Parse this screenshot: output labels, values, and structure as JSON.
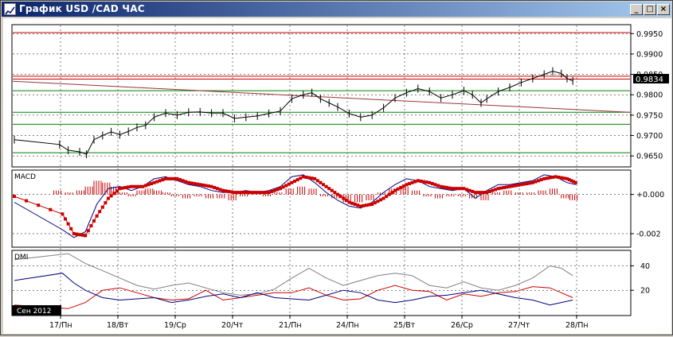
{
  "window": {
    "title": "График USD /CAD  ЧАС",
    "minimize_label": "_",
    "maximize_label": "□",
    "close_label": "×"
  },
  "price_panel": {
    "ticks": [
      "0.9950",
      "0.9900",
      "0.9850",
      "0.9800",
      "0.9750",
      "0.9700",
      "0.9650"
    ],
    "current_price": "0.9834",
    "current_price_value": 0.9834,
    "ylim": [
      0.9625,
      0.997
    ],
    "horizontal_levels": [
      {
        "value": 0.99525,
        "color": "#cc0000"
      },
      {
        "value": 0.98455,
        "color": "#cc0000"
      },
      {
        "value": 0.98385,
        "color": "#cc0000"
      },
      {
        "value": 0.981,
        "color": "#008000"
      },
      {
        "value": 0.9757,
        "color": "#008000"
      },
      {
        "value": 0.97275,
        "color": "#008000"
      },
      {
        "value": 0.9658,
        "color": "#008000"
      }
    ],
    "trendline": {
      "color": "#993333",
      "start": [
        0.0,
        0.9833
      ],
      "end": [
        10.4,
        0.9757
      ]
    },
    "price_series": [
      [
        0.0,
        0.969
      ],
      [
        0.15,
        0.9678
      ],
      [
        0.3,
        0.9664
      ],
      [
        0.5,
        0.966
      ],
      [
        0.62,
        0.9654
      ],
      [
        0.75,
        0.969
      ],
      [
        0.9,
        0.97
      ],
      [
        1.05,
        0.9709
      ],
      [
        1.2,
        0.9702
      ],
      [
        1.35,
        0.971
      ],
      [
        1.5,
        0.972
      ],
      [
        1.65,
        0.9725
      ],
      [
        1.8,
        0.9745
      ],
      [
        2.0,
        0.9755
      ],
      [
        2.2,
        0.975
      ],
      [
        2.4,
        0.9757
      ],
      [
        2.6,
        0.9758
      ],
      [
        2.8,
        0.9755
      ],
      [
        3.0,
        0.9755
      ],
      [
        3.2,
        0.9742
      ],
      [
        3.4,
        0.9745
      ],
      [
        3.6,
        0.9748
      ],
      [
        3.8,
        0.9754
      ],
      [
        4.0,
        0.976
      ],
      [
        4.2,
        0.979
      ],
      [
        4.4,
        0.98
      ],
      [
        4.55,
        0.9805
      ],
      [
        4.7,
        0.979
      ],
      [
        4.85,
        0.978
      ],
      [
        5.0,
        0.977
      ],
      [
        5.2,
        0.9754
      ],
      [
        5.4,
        0.9745
      ],
      [
        5.6,
        0.975
      ],
      [
        5.8,
        0.9768
      ],
      [
        6.0,
        0.9792
      ],
      [
        6.2,
        0.9805
      ],
      [
        6.4,
        0.9815
      ],
      [
        6.6,
        0.9808
      ],
      [
        6.8,
        0.9792
      ],
      [
        7.0,
        0.98
      ],
      [
        7.2,
        0.981
      ],
      [
        7.35,
        0.98
      ],
      [
        7.5,
        0.978
      ],
      [
        7.6,
        0.979
      ],
      [
        7.8,
        0.9808
      ],
      [
        8.0,
        0.9818
      ],
      [
        8.2,
        0.983
      ],
      [
        8.4,
        0.984
      ],
      [
        8.6,
        0.985
      ],
      [
        8.75,
        0.9858
      ],
      [
        8.9,
        0.9852
      ],
      [
        9.0,
        0.984
      ],
      [
        9.1,
        0.9834
      ]
    ]
  },
  "macd_panel": {
    "label": "MACD",
    "ticks": [
      "+0.000",
      "-0.002"
    ],
    "ylim": [
      -0.00265,
      0.0012
    ],
    "histogram_color": "#cc0000",
    "histogram": [
      [
        0.05,
        0.0002
      ],
      [
        0.25,
        0.0001
      ],
      [
        0.45,
        0.0002
      ],
      [
        0.6,
        0.0004
      ],
      [
        0.75,
        0.0007
      ],
      [
        0.9,
        0.0006
      ],
      [
        1.05,
        0.0004
      ],
      [
        1.2,
        0.0001
      ],
      [
        1.35,
        -0.0001
      ],
      [
        1.5,
        0.0002
      ],
      [
        1.65,
        0.0003
      ],
      [
        1.8,
        0.0002
      ],
      [
        1.95,
        0.0001
      ],
      [
        2.1,
        -0.0001
      ],
      [
        2.3,
        -0.0002
      ],
      [
        2.5,
        -0.0001
      ],
      [
        2.7,
        -0.0002
      ],
      [
        2.9,
        -0.0002
      ],
      [
        3.1,
        -0.0003
      ],
      [
        3.3,
        -0.0001
      ],
      [
        3.5,
        0.0001
      ],
      [
        3.7,
        -0.0001
      ],
      [
        3.9,
        0.0001
      ],
      [
        4.1,
        0.0003
      ],
      [
        4.3,
        0.0004
      ],
      [
        4.5,
        0.0003
      ],
      [
        4.7,
        -0.0001
      ],
      [
        4.9,
        -0.0002
      ],
      [
        5.1,
        -0.0004
      ],
      [
        5.3,
        -0.0004
      ],
      [
        5.5,
        -0.0003
      ],
      [
        5.7,
        0.0001
      ],
      [
        5.9,
        0.0003
      ],
      [
        6.1,
        0.0004
      ],
      [
        6.3,
        0.0002
      ],
      [
        6.5,
        -0.0001
      ],
      [
        6.7,
        -0.0002
      ],
      [
        6.9,
        -0.0001
      ],
      [
        7.1,
        -0.0001
      ],
      [
        7.3,
        -0.0002
      ],
      [
        7.5,
        -0.0003
      ],
      [
        7.7,
        0.0001
      ],
      [
        7.9,
        0.0002
      ],
      [
        8.1,
        0.0001
      ],
      [
        8.3,
        0.0001
      ],
      [
        8.5,
        0.0002
      ],
      [
        8.7,
        0.0003
      ],
      [
        8.9,
        -0.0002
      ],
      [
        9.05,
        -0.0003
      ]
    ],
    "macd_line": {
      "color": "#000080",
      "points": [
        [
          0.0,
          -0.0004
        ],
        [
          0.2,
          -0.0018
        ],
        [
          0.4,
          -0.0022
        ],
        [
          0.6,
          -0.0019
        ],
        [
          0.8,
          -0.0005
        ],
        [
          1.0,
          0.0003
        ],
        [
          1.2,
          0.0004
        ],
        [
          1.4,
          0.0002
        ],
        [
          1.6,
          0.0004
        ],
        [
          1.8,
          0.0008
        ],
        [
          2.0,
          0.0009
        ],
        [
          2.2,
          0.0007
        ],
        [
          2.4,
          0.0005
        ],
        [
          2.6,
          0.0004
        ],
        [
          2.8,
          0.0002
        ],
        [
          3.0,
          0.0001
        ],
        [
          3.2,
          0.0001
        ],
        [
          3.4,
          0.0002
        ],
        [
          3.6,
          0.0001
        ],
        [
          3.8,
          0.0002
        ],
        [
          4.0,
          0.0004
        ],
        [
          4.2,
          0.0009
        ],
        [
          4.4,
          0.001
        ],
        [
          4.6,
          0.0006
        ],
        [
          4.8,
          0.0001
        ],
        [
          5.0,
          -0.0003
        ],
        [
          5.2,
          -0.0006
        ],
        [
          5.4,
          -0.0007
        ],
        [
          5.6,
          -0.0004
        ],
        [
          5.8,
          0.0001
        ],
        [
          6.0,
          0.0005
        ],
        [
          6.2,
          0.0008
        ],
        [
          6.4,
          0.0007
        ],
        [
          6.6,
          0.0004
        ],
        [
          6.8,
          0.0003
        ],
        [
          7.0,
          0.0002
        ],
        [
          7.2,
          0.0003
        ],
        [
          7.4,
          -0.0002
        ],
        [
          7.6,
          0.0002
        ],
        [
          7.8,
          0.0005
        ],
        [
          8.0,
          0.0005
        ],
        [
          8.2,
          0.0006
        ],
        [
          8.4,
          0.0007
        ],
        [
          8.6,
          0.001
        ],
        [
          8.8,
          0.0009
        ],
        [
          9.0,
          0.0006
        ],
        [
          9.15,
          0.0005
        ]
      ]
    },
    "signal_line": {
      "color": "#cc0000",
      "points": [
        [
          0.0,
          -0.0001
        ],
        [
          0.2,
          -0.001
        ],
        [
          0.4,
          -0.002
        ],
        [
          0.6,
          -0.0021
        ],
        [
          0.8,
          -0.0011
        ],
        [
          1.0,
          -0.0002
        ],
        [
          1.2,
          0.0003
        ],
        [
          1.4,
          0.0004
        ],
        [
          1.6,
          0.0004
        ],
        [
          1.8,
          0.0006
        ],
        [
          2.0,
          0.0008
        ],
        [
          2.2,
          0.0008
        ],
        [
          2.4,
          0.0006
        ],
        [
          2.6,
          0.0005
        ],
        [
          2.8,
          0.0004
        ],
        [
          3.0,
          0.0002
        ],
        [
          3.2,
          0.0001
        ],
        [
          3.4,
          0.0001
        ],
        [
          3.6,
          0.0001
        ],
        [
          3.8,
          0.0001
        ],
        [
          4.0,
          0.0003
        ],
        [
          4.2,
          0.0006
        ],
        [
          4.4,
          0.0009
        ],
        [
          4.6,
          0.0008
        ],
        [
          4.8,
          0.0004
        ],
        [
          5.0,
          0.0
        ],
        [
          5.2,
          -0.0004
        ],
        [
          5.4,
          -0.0006
        ],
        [
          5.6,
          -0.0005
        ],
        [
          5.8,
          -0.0002
        ],
        [
          6.0,
          0.0002
        ],
        [
          6.2,
          0.0005
        ],
        [
          6.4,
          0.0007
        ],
        [
          6.6,
          0.0006
        ],
        [
          6.8,
          0.0004
        ],
        [
          7.0,
          0.0003
        ],
        [
          7.2,
          0.0003
        ],
        [
          7.4,
          0.0001
        ],
        [
          7.6,
          0.0001
        ],
        [
          7.8,
          0.0003
        ],
        [
          8.0,
          0.0004
        ],
        [
          8.2,
          0.0005
        ],
        [
          8.4,
          0.0006
        ],
        [
          8.6,
          0.0008
        ],
        [
          8.8,
          0.0009
        ],
        [
          9.0,
          0.0008
        ],
        [
          9.15,
          0.0006
        ]
      ]
    }
  },
  "dmi_panel": {
    "label": "DMI",
    "ticks": [
      "40",
      "20"
    ],
    "ylim": [
      0,
      52
    ],
    "adx": {
      "color": "#808080",
      "points": [
        [
          0.0,
          45
        ],
        [
          0.3,
          50
        ],
        [
          0.6,
          42
        ],
        [
          0.9,
          36
        ],
        [
          1.2,
          30
        ],
        [
          1.5,
          24
        ],
        [
          1.8,
          21
        ],
        [
          2.1,
          24
        ],
        [
          2.4,
          26
        ],
        [
          2.7,
          22
        ],
        [
          3.0,
          18
        ],
        [
          3.3,
          16
        ],
        [
          3.6,
          17
        ],
        [
          3.9,
          21
        ],
        [
          4.2,
          30
        ],
        [
          4.5,
          38
        ],
        [
          4.8,
          30
        ],
        [
          5.1,
          24
        ],
        [
          5.4,
          28
        ],
        [
          5.7,
          32
        ],
        [
          6.0,
          34
        ],
        [
          6.3,
          32
        ],
        [
          6.6,
          24
        ],
        [
          6.9,
          22
        ],
        [
          7.2,
          27
        ],
        [
          7.5,
          22
        ],
        [
          7.8,
          20
        ],
        [
          8.1,
          24
        ],
        [
          8.4,
          30
        ],
        [
          8.7,
          40
        ],
        [
          8.9,
          38
        ],
        [
          9.1,
          32
        ]
      ]
    },
    "plus_di": {
      "color": "#cc0000",
      "points": [
        [
          0.0,
          8
        ],
        [
          0.3,
          5
        ],
        [
          0.6,
          10
        ],
        [
          0.9,
          20
        ],
        [
          1.2,
          22
        ],
        [
          1.5,
          18
        ],
        [
          1.8,
          14
        ],
        [
          2.1,
          12
        ],
        [
          2.4,
          13
        ],
        [
          2.7,
          20
        ],
        [
          3.0,
          12
        ],
        [
          3.3,
          14
        ],
        [
          3.6,
          16
        ],
        [
          3.9,
          18
        ],
        [
          4.2,
          18
        ],
        [
          4.5,
          22
        ],
        [
          4.8,
          16
        ],
        [
          5.1,
          12
        ],
        [
          5.4,
          13
        ],
        [
          5.7,
          20
        ],
        [
          6.0,
          24
        ],
        [
          6.3,
          20
        ],
        [
          6.6,
          19
        ],
        [
          6.9,
          12
        ],
        [
          7.2,
          17
        ],
        [
          7.5,
          15
        ],
        [
          7.8,
          18
        ],
        [
          8.1,
          19
        ],
        [
          8.4,
          23
        ],
        [
          8.7,
          22
        ],
        [
          8.9,
          18
        ],
        [
          9.1,
          14
        ]
      ]
    },
    "minus_di": {
      "color": "#000080",
      "points": [
        [
          0.0,
          28
        ],
        [
          0.2,
          34
        ],
        [
          0.4,
          26
        ],
        [
          0.6,
          20
        ],
        [
          0.9,
          14
        ],
        [
          1.2,
          12
        ],
        [
          1.5,
          13
        ],
        [
          1.8,
          14
        ],
        [
          2.1,
          10
        ],
        [
          2.4,
          12
        ],
        [
          2.7,
          15
        ],
        [
          3.0,
          17
        ],
        [
          3.3,
          14
        ],
        [
          3.6,
          18
        ],
        [
          3.9,
          14
        ],
        [
          4.2,
          13
        ],
        [
          4.5,
          12
        ],
        [
          4.8,
          16
        ],
        [
          5.1,
          20
        ],
        [
          5.4,
          18
        ],
        [
          5.7,
          12
        ],
        [
          6.0,
          10
        ],
        [
          6.3,
          12
        ],
        [
          6.6,
          15
        ],
        [
          6.9,
          16
        ],
        [
          7.2,
          18
        ],
        [
          7.5,
          20
        ],
        [
          7.8,
          17
        ],
        [
          8.1,
          14
        ],
        [
          8.4,
          12
        ],
        [
          8.7,
          8
        ],
        [
          8.9,
          10
        ],
        [
          9.1,
          12
        ]
      ]
    }
  },
  "x_axis": {
    "labels": [
      "17/Пн",
      "18/Вт",
      "19/Ср",
      "20/Чт",
      "21/Пн",
      "24/Пн",
      "25/Вт",
      "26/Ср",
      "27/Чт",
      "28/Пн"
    ],
    "period_label": "Сен 2012"
  }
}
